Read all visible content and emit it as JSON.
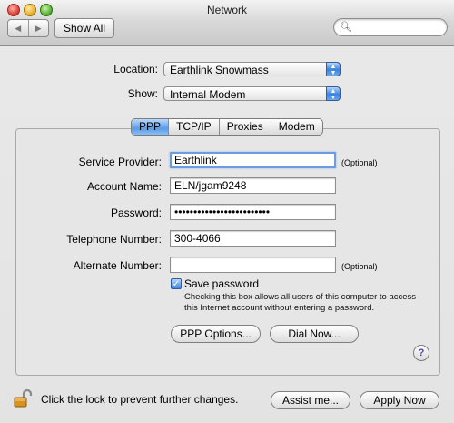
{
  "window": {
    "title": "Network"
  },
  "toolbar": {
    "back_glyph": "◀",
    "forward_glyph": "▶",
    "show_all_label": "Show All",
    "search_value": "",
    "search_icon": "magnifier-icon"
  },
  "location": {
    "label": "Location:",
    "value": "Earthlink Snowmass"
  },
  "show": {
    "label": "Show:",
    "value": "Internal Modem"
  },
  "tabs": [
    {
      "label": "PPP",
      "active": true
    },
    {
      "label": "TCP/IP",
      "active": false
    },
    {
      "label": "Proxies",
      "active": false
    },
    {
      "label": "Modem",
      "active": false
    }
  ],
  "form": {
    "service_provider": {
      "label": "Service Provider:",
      "value": "Earthlink",
      "optional": "(Optional)"
    },
    "account_name": {
      "label": "Account Name:",
      "value": "ELN/jgam9248"
    },
    "password": {
      "label": "Password:",
      "value": "•••••••••••••••••••••••••"
    },
    "telephone": {
      "label": "Telephone Number:",
      "value": "300-4066"
    },
    "alternate": {
      "label": "Alternate Number:",
      "value": "",
      "optional": "(Optional)"
    }
  },
  "save_password": {
    "checked": true,
    "check_glyph": "✓",
    "label": "Save password",
    "help": "Checking this box allows all users of this computer to access this Internet account without entering a password."
  },
  "buttons": {
    "ppp_options": "PPP Options...",
    "dial_now": "Dial Now...",
    "help": "?",
    "assist_me": "Assist me...",
    "apply_now": "Apply Now"
  },
  "footer": {
    "lock_text": "Click the lock to prevent further changes."
  },
  "colors": {
    "accent": "#3b82dd",
    "lock": "#d8921f",
    "help": "#5b3fa6"
  }
}
